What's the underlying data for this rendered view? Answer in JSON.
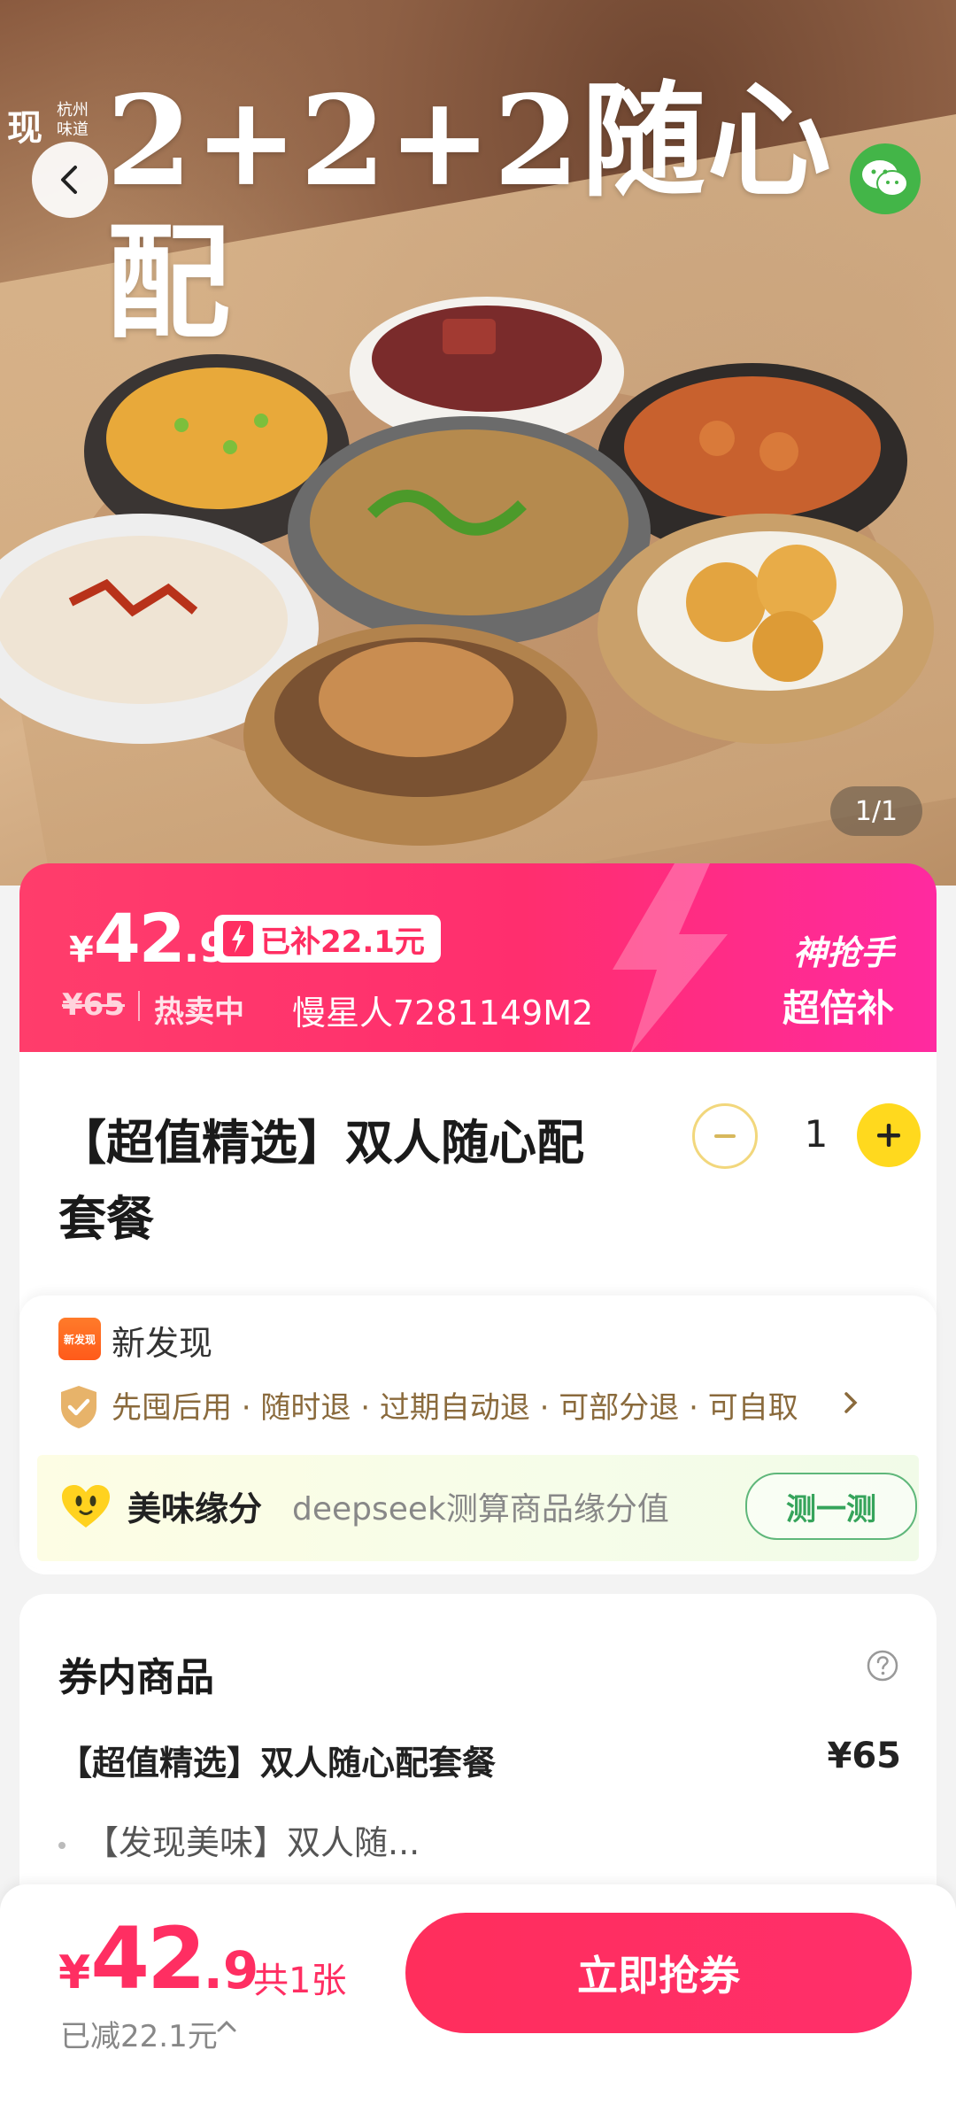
{
  "hero": {
    "brand_main": "现",
    "brand_sub": "杭州味道",
    "banner_text": "2+2+2随心配",
    "image_counter": "1/1"
  },
  "price_banner": {
    "currency": "¥",
    "price_int": "42",
    "price_dec": ".9",
    "subsidy_label": "已补22.1元",
    "original_price": "¥65",
    "hot_label": "热卖中",
    "user_label": "慢星人7281149M2",
    "promo_line1": "神抢手",
    "promo_line2": "超倍补"
  },
  "product": {
    "title": "【超值精选】双人随心配套餐",
    "quantity": "1",
    "merchant_logo_text": "新发现",
    "merchant_name": "新发现",
    "guarantee": "先囤后用 · 随时退 · 过期自动退 · 可部分退 · 可自取",
    "match_label": "美味缘分",
    "match_desc": "deepseek测算商品缘分值",
    "match_button": "测一测"
  },
  "items": {
    "title": "券内商品",
    "item_name": "【超值精选】双人随心配套餐",
    "item_price": "¥65",
    "sub_item": "【发现美味】双人随..."
  },
  "bottom": {
    "currency": "¥",
    "price_int": "42",
    "price_dec": ".9",
    "count": "共1张",
    "discount": "已减22.1元",
    "buy_button": "立即抢券"
  },
  "colors": {
    "accent_pink": "#ff2e62",
    "stepper_yellow": "#ffd91e",
    "match_green": "#36a45b",
    "wechat_green": "#43b548"
  },
  "icons": [
    "back-arrow-icon",
    "wechat-icon",
    "bolt-icon",
    "minus-icon",
    "plus-icon",
    "shield-check-icon",
    "chevron-right-icon",
    "heart-face-icon",
    "question-circle-icon",
    "chevron-up-icon"
  ]
}
